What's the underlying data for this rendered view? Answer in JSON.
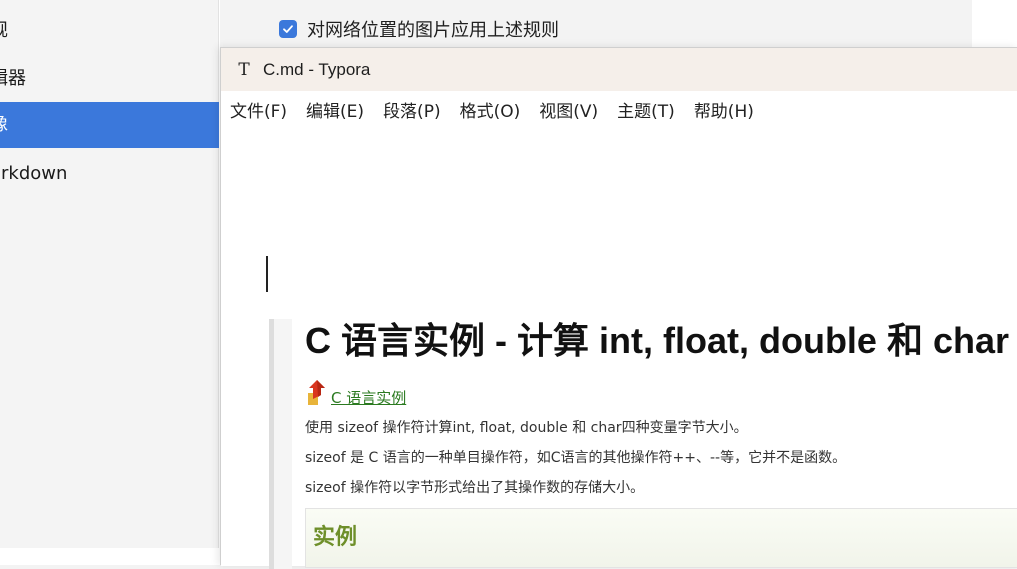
{
  "background_window": {
    "sidebar_items": [
      {
        "label": "规"
      },
      {
        "label": "辑器"
      },
      {
        "label": "像",
        "active": true
      },
      {
        "label": "arkdown"
      }
    ],
    "checkbox_label": "对网络位置的图片应用上述规则",
    "checkbox_checked": true
  },
  "typora": {
    "icon": "T",
    "title": "C.md - Typora",
    "menu": [
      "文件(F)",
      "编辑(E)",
      "段落(P)",
      "格式(O)",
      "视图(V)",
      "主题(T)",
      "帮助(H)"
    ]
  },
  "article": {
    "heading": "C 语言实例 - 计算 int, float, double 和 char",
    "crumb_link": "C 语言实例",
    "paragraphs": [
      "使用 sizeof 操作符计算int, float, double 和 char四种变量字节大小。",
      "sizeof 是 C 语言的一种单目操作符，如C语言的其他操作符++、--等，它并不是函数。",
      "sizeof 操作符以字节形式给出了其操作数的存储大小。"
    ],
    "example_title": "实例"
  },
  "colors": {
    "accent": "#3b78db",
    "titlebar": "#f5efea",
    "link": "#2b7a20",
    "example_title": "#6e8f2a"
  }
}
